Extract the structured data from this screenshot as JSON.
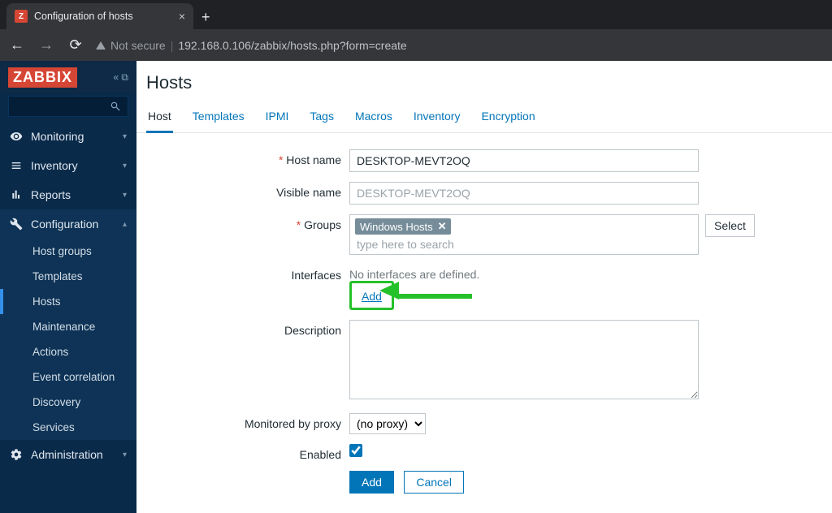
{
  "browser": {
    "tab_title": "Configuration of hosts",
    "url_prefix": "Not secure",
    "url": "192.168.0.106/zabbix/hosts.php?form=create"
  },
  "logo": "ZABBIX",
  "sidebar": {
    "items": [
      {
        "label": "Monitoring"
      },
      {
        "label": "Inventory"
      },
      {
        "label": "Reports"
      },
      {
        "label": "Configuration"
      },
      {
        "label": "Administration"
      }
    ],
    "config_sub": [
      {
        "label": "Host groups"
      },
      {
        "label": "Templates"
      },
      {
        "label": "Hosts"
      },
      {
        "label": "Maintenance"
      },
      {
        "label": "Actions"
      },
      {
        "label": "Event correlation"
      },
      {
        "label": "Discovery"
      },
      {
        "label": "Services"
      }
    ]
  },
  "page_title": "Hosts",
  "tabs": [
    {
      "label": "Host"
    },
    {
      "label": "Templates"
    },
    {
      "label": "IPMI"
    },
    {
      "label": "Tags"
    },
    {
      "label": "Macros"
    },
    {
      "label": "Inventory"
    },
    {
      "label": "Encryption"
    }
  ],
  "form": {
    "host_name_label": "Host name",
    "host_name_value": "DESKTOP-MEVT2OQ",
    "visible_name_label": "Visible name",
    "visible_name_placeholder": "DESKTOP-MEVT2OQ",
    "groups_label": "Groups",
    "group_chip": "Windows Hosts",
    "group_search_placeholder": "type here to search",
    "select_btn": "Select",
    "interfaces_label": "Interfaces",
    "interfaces_empty": "No interfaces are defined.",
    "interfaces_add": "Add",
    "description_label": "Description",
    "proxy_label": "Monitored by proxy",
    "proxy_value": "(no proxy)",
    "enabled_label": "Enabled",
    "submit_add": "Add",
    "submit_cancel": "Cancel"
  }
}
